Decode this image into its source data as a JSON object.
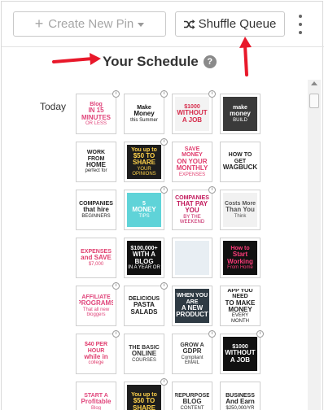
{
  "toolbar": {
    "create_label": "Create New Pin",
    "shuffle_label": "Shuffle Queue"
  },
  "schedule": {
    "title": "Your Schedule",
    "help": "?",
    "day_label": "Today"
  },
  "pins": [
    {
      "l1": "Blog",
      "l2": "IN 15 MINUTES",
      "l3": "OR LESS",
      "bg": "#ffffff",
      "fg": "#e0457b"
    },
    {
      "l1": "Make",
      "l2": "Money",
      "l3": "this Summer",
      "bg": "#ffffff",
      "fg": "#111111"
    },
    {
      "l1": "$1000",
      "l2": "WITHOUT A JOB",
      "l3": "",
      "bg": "#f3f3f3",
      "fg": "#d62a4a"
    },
    {
      "l1": "make",
      "l2": "money",
      "l3": "BUILD",
      "bg": "#3a3a3a",
      "fg": "#ffffff"
    },
    {
      "l1": "WORK FROM",
      "l2": "HOME",
      "l3": "perfect for",
      "bg": "#ffffff",
      "fg": "#222222"
    },
    {
      "l1": "You up to",
      "l2": "$50 TO SHARE",
      "l3": "YOUR OPINIONS",
      "bg": "#1d1d1d",
      "fg": "#ffd24a"
    },
    {
      "l1": "SAVE MONEY",
      "l2": "ON YOUR MONTHLY",
      "l3": "EXPENSES",
      "bg": "#ffffff",
      "fg": "#e03d6e"
    },
    {
      "l1": "HOW TO GET",
      "l2": "SWAGBUCKS",
      "l3": "",
      "bg": "#ffffff",
      "fg": "#222222"
    },
    {
      "l1": "COMPANIES",
      "l2": "that hire",
      "l3": "BEGINNERS",
      "bg": "#ffffff",
      "fg": "#222222"
    },
    {
      "l1": "5",
      "l2": "MONEY",
      "l3": "TIPS",
      "bg": "#5fd3d8",
      "fg": "#ffffff"
    },
    {
      "l1": "COMPANIES",
      "l2": "THAT PAY YOU",
      "l3": "BY THE WEEKEND",
      "bg": "#ffffff",
      "fg": "#c2185b"
    },
    {
      "l1": "Costs More",
      "l2": "Than You",
      "l3": "Think",
      "bg": "#f1f1f1",
      "fg": "#555555"
    },
    {
      "l1": "EXPENSES",
      "l2": "and SAVE",
      "l3": "$7,000",
      "bg": "#ffffff",
      "fg": "#e03d6e"
    },
    {
      "l1": "$100,000+",
      "l2": "WITH A BLOG",
      "l3": "IN A YEAR OR",
      "bg": "#111111",
      "fg": "#ffffff"
    },
    {
      "l1": "",
      "l2": "",
      "l3": "",
      "bg": "#e8eef3",
      "fg": "#333333"
    },
    {
      "l1": "How to",
      "l2": "Start Working",
      "l3": "From Home",
      "bg": "#111111",
      "fg": "#ff3b7a"
    },
    {
      "l1": "AFFILIATE",
      "l2": "PROGRAMS",
      "l3": "That all new bloggers",
      "bg": "#ffffff",
      "fg": "#e0457b"
    },
    {
      "l1": "DELICIOUS",
      "l2": "PASTA SALADS",
      "l3": "",
      "bg": "#ffffff",
      "fg": "#222222"
    },
    {
      "l1": "WHEN YOU ARE",
      "l2": "A NEW PRODUCT",
      "l3": "",
      "bg": "#2f3b44",
      "fg": "#ffffff"
    },
    {
      "l1": "APP YOU NEED",
      "l2": "TO MAKE MONEY",
      "l3": "EVERY MONTH",
      "bg": "#ffffff",
      "fg": "#222222"
    },
    {
      "l1": "$40 PER HOUR",
      "l2": "while in",
      "l3": "college",
      "bg": "#ffffff",
      "fg": "#e03d6e"
    },
    {
      "l1": "THE BASIC",
      "l2": "ONLINE",
      "l3": "COURSES",
      "bg": "#ffffff",
      "fg": "#333333"
    },
    {
      "l1": "GROW A",
      "l2": "GDPR",
      "l3": "Compliant EMAIL",
      "bg": "#ffffff",
      "fg": "#333333"
    },
    {
      "l1": "$1000",
      "l2": "WITHOUT A JOB",
      "l3": "",
      "bg": "#111111",
      "fg": "#ffffff"
    },
    {
      "l1": "START A",
      "l2": "Profitable",
      "l3": "Blog",
      "bg": "#ffffff",
      "fg": "#e0457b"
    },
    {
      "l1": "You up to",
      "l2": "$50 TO SHARE",
      "l3": "",
      "bg": "#1d1d1d",
      "fg": "#ffd24a"
    },
    {
      "l1": "REPURPOSE",
      "l2": "BLOG",
      "l3": "CONTENT",
      "bg": "#ffffff",
      "fg": "#333333"
    },
    {
      "l1": "BUSINESS",
      "l2": "And Earn",
      "l3": "$250,000/YR",
      "bg": "#ffffff",
      "fg": "#222222"
    }
  ],
  "colors": {
    "arrow": "#e8182a",
    "accent_pink": "#e0457b"
  }
}
